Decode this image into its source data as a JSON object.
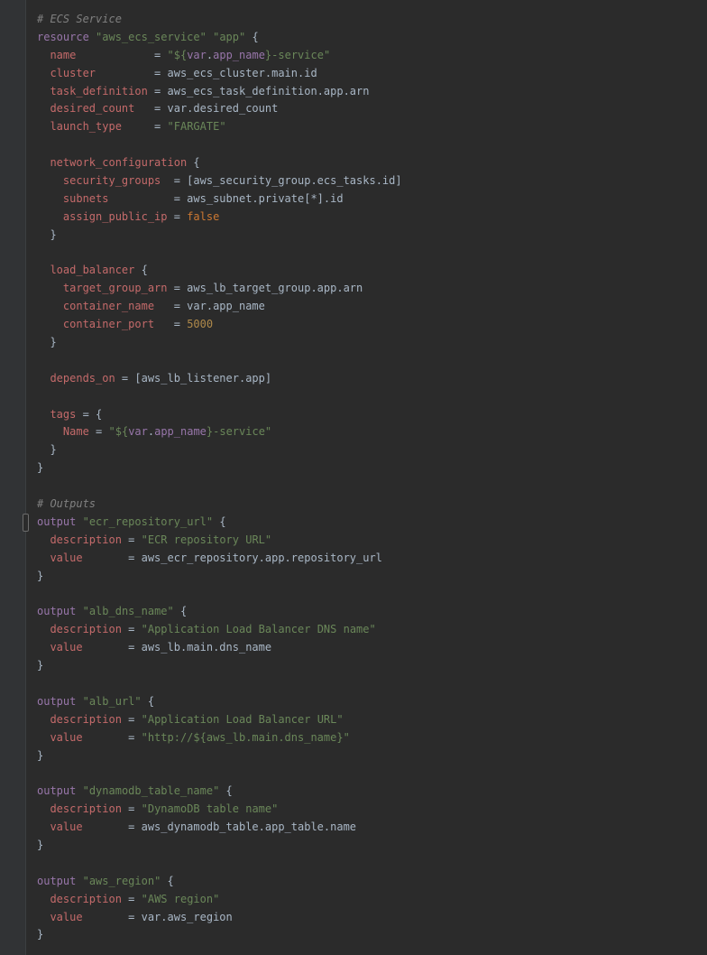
{
  "editor": {
    "language": "hcl",
    "lines": [
      [
        {
          "t": "# ECS Service",
          "c": "comment"
        }
      ],
      [
        {
          "t": "resource",
          "c": "block"
        },
        {
          "t": " ",
          "c": "text"
        },
        {
          "t": "\"aws_ecs_service\"",
          "c": "string"
        },
        {
          "t": " ",
          "c": "text"
        },
        {
          "t": "\"app\"",
          "c": "string"
        },
        {
          "t": " {",
          "c": "text"
        }
      ],
      [
        {
          "t": "  ",
          "c": "text"
        },
        {
          "t": "name",
          "c": "attr"
        },
        {
          "t": "            = ",
          "c": "text"
        },
        {
          "t": "\"${",
          "c": "string"
        },
        {
          "t": "var",
          "c": "block"
        },
        {
          "t": ".",
          "c": "text"
        },
        {
          "t": "app_name",
          "c": "block"
        },
        {
          "t": "}-service\"",
          "c": "string"
        }
      ],
      [
        {
          "t": "  ",
          "c": "text"
        },
        {
          "t": "cluster",
          "c": "attr"
        },
        {
          "t": "         = aws_ecs_cluster.main.id",
          "c": "text"
        }
      ],
      [
        {
          "t": "  ",
          "c": "text"
        },
        {
          "t": "task_definition",
          "c": "attr"
        },
        {
          "t": " = aws_ecs_task_definition.app.arn",
          "c": "text"
        }
      ],
      [
        {
          "t": "  ",
          "c": "text"
        },
        {
          "t": "desired_count",
          "c": "attr"
        },
        {
          "t": "   = var.desired_count",
          "c": "text"
        }
      ],
      [
        {
          "t": "  ",
          "c": "text"
        },
        {
          "t": "launch_type",
          "c": "attr"
        },
        {
          "t": "     = ",
          "c": "text"
        },
        {
          "t": "\"FARGATE\"",
          "c": "string"
        }
      ],
      [],
      [
        {
          "t": "  ",
          "c": "text"
        },
        {
          "t": "network_configuration",
          "c": "attr"
        },
        {
          "t": " {",
          "c": "text"
        }
      ],
      [
        {
          "t": "    ",
          "c": "text"
        },
        {
          "t": "security_groups",
          "c": "attr"
        },
        {
          "t": "  = [aws_security_group.ecs_tasks.id]",
          "c": "text"
        }
      ],
      [
        {
          "t": "    ",
          "c": "text"
        },
        {
          "t": "subnets",
          "c": "attr"
        },
        {
          "t": "          = aws_subnet.private[*].id",
          "c": "text"
        }
      ],
      [
        {
          "t": "    ",
          "c": "text"
        },
        {
          "t": "assign_public_ip",
          "c": "attr"
        },
        {
          "t": " = ",
          "c": "text"
        },
        {
          "t": "false",
          "c": "bool"
        }
      ],
      [
        {
          "t": "  }",
          "c": "text"
        }
      ],
      [],
      [
        {
          "t": "  ",
          "c": "text"
        },
        {
          "t": "load_balancer",
          "c": "attr"
        },
        {
          "t": " {",
          "c": "text"
        }
      ],
      [
        {
          "t": "    ",
          "c": "text"
        },
        {
          "t": "target_group_arn",
          "c": "attr"
        },
        {
          "t": " = aws_lb_target_group.app.arn",
          "c": "text"
        }
      ],
      [
        {
          "t": "    ",
          "c": "text"
        },
        {
          "t": "container_name",
          "c": "attr"
        },
        {
          "t": "   = var.app_name",
          "c": "text"
        }
      ],
      [
        {
          "t": "    ",
          "c": "text"
        },
        {
          "t": "container_port",
          "c": "attr"
        },
        {
          "t": "   = ",
          "c": "text"
        },
        {
          "t": "5000",
          "c": "var"
        }
      ],
      [
        {
          "t": "  }",
          "c": "text"
        }
      ],
      [],
      [
        {
          "t": "  ",
          "c": "text"
        },
        {
          "t": "depends_on",
          "c": "attr"
        },
        {
          "t": " = [aws_lb_listener.app]",
          "c": "text"
        }
      ],
      [],
      [
        {
          "t": "  ",
          "c": "text"
        },
        {
          "t": "tags",
          "c": "attr"
        },
        {
          "t": " = {",
          "c": "text"
        }
      ],
      [
        {
          "t": "    ",
          "c": "text"
        },
        {
          "t": "Name",
          "c": "attr"
        },
        {
          "t": " = ",
          "c": "text"
        },
        {
          "t": "\"${",
          "c": "string"
        },
        {
          "t": "var",
          "c": "block"
        },
        {
          "t": ".",
          "c": "text"
        },
        {
          "t": "app_name",
          "c": "block"
        },
        {
          "t": "}-service\"",
          "c": "string"
        }
      ],
      [
        {
          "t": "  }",
          "c": "text"
        }
      ],
      [
        {
          "t": "}",
          "c": "text"
        }
      ],
      [],
      [
        {
          "t": "# Outputs",
          "c": "comment"
        }
      ],
      [
        {
          "t": "output",
          "c": "block"
        },
        {
          "t": " ",
          "c": "text"
        },
        {
          "t": "\"ecr_repository_url\"",
          "c": "string"
        },
        {
          "t": " {",
          "c": "text"
        }
      ],
      [
        {
          "t": "  ",
          "c": "text"
        },
        {
          "t": "description",
          "c": "attr"
        },
        {
          "t": " = ",
          "c": "text"
        },
        {
          "t": "\"ECR repository URL\"",
          "c": "string"
        }
      ],
      [
        {
          "t": "  ",
          "c": "text"
        },
        {
          "t": "value",
          "c": "attr"
        },
        {
          "t": "       = aws_ecr_repository.app.repository_url",
          "c": "text"
        }
      ],
      [
        {
          "t": "}",
          "c": "text"
        }
      ],
      [],
      [
        {
          "t": "output",
          "c": "block"
        },
        {
          "t": " ",
          "c": "text"
        },
        {
          "t": "\"alb_dns_name\"",
          "c": "string"
        },
        {
          "t": " {",
          "c": "text"
        }
      ],
      [
        {
          "t": "  ",
          "c": "text"
        },
        {
          "t": "description",
          "c": "attr"
        },
        {
          "t": " = ",
          "c": "text"
        },
        {
          "t": "\"Application Load Balancer DNS name\"",
          "c": "string"
        }
      ],
      [
        {
          "t": "  ",
          "c": "text"
        },
        {
          "t": "value",
          "c": "attr"
        },
        {
          "t": "       = aws_lb.main.dns_name",
          "c": "text"
        }
      ],
      [
        {
          "t": "}",
          "c": "text"
        }
      ],
      [],
      [
        {
          "t": "output",
          "c": "block"
        },
        {
          "t": " ",
          "c": "text"
        },
        {
          "t": "\"alb_url\"",
          "c": "string"
        },
        {
          "t": " {",
          "c": "text"
        }
      ],
      [
        {
          "t": "  ",
          "c": "text"
        },
        {
          "t": "description",
          "c": "attr"
        },
        {
          "t": " = ",
          "c": "text"
        },
        {
          "t": "\"Application Load Balancer URL\"",
          "c": "string"
        }
      ],
      [
        {
          "t": "  ",
          "c": "text"
        },
        {
          "t": "value",
          "c": "attr"
        },
        {
          "t": "       = ",
          "c": "text"
        },
        {
          "t": "\"http://${aws_lb.main.dns_name}\"",
          "c": "string"
        }
      ],
      [
        {
          "t": "}",
          "c": "text"
        }
      ],
      [],
      [
        {
          "t": "output",
          "c": "block"
        },
        {
          "t": " ",
          "c": "text"
        },
        {
          "t": "\"dynamodb_table_name\"",
          "c": "string"
        },
        {
          "t": " {",
          "c": "text"
        }
      ],
      [
        {
          "t": "  ",
          "c": "text"
        },
        {
          "t": "description",
          "c": "attr"
        },
        {
          "t": " = ",
          "c": "text"
        },
        {
          "t": "\"DynamoDB table name\"",
          "c": "string"
        }
      ],
      [
        {
          "t": "  ",
          "c": "text"
        },
        {
          "t": "value",
          "c": "attr"
        },
        {
          "t": "       = aws_dynamodb_table.app_table.name",
          "c": "text"
        }
      ],
      [
        {
          "t": "}",
          "c": "text"
        }
      ],
      [],
      [
        {
          "t": "output",
          "c": "block"
        },
        {
          "t": " ",
          "c": "text"
        },
        {
          "t": "\"aws_region\"",
          "c": "string"
        },
        {
          "t": " {",
          "c": "text"
        }
      ],
      [
        {
          "t": "  ",
          "c": "text"
        },
        {
          "t": "description",
          "c": "attr"
        },
        {
          "t": " = ",
          "c": "text"
        },
        {
          "t": "\"AWS region\"",
          "c": "string"
        }
      ],
      [
        {
          "t": "  ",
          "c": "text"
        },
        {
          "t": "value",
          "c": "attr"
        },
        {
          "t": "       = var.aws_region",
          "c": "text"
        }
      ],
      [
        {
          "t": "}",
          "c": "text"
        }
      ]
    ]
  },
  "colors": {
    "background": "#2b2b2b",
    "gutter": "#313335",
    "comment": "#808080",
    "block": "#9876aa",
    "string": "#6a8759",
    "attribute": "#c46a6a",
    "text": "#a9b7c6",
    "number": "#b08a4a",
    "boolean": "#cc7832"
  }
}
